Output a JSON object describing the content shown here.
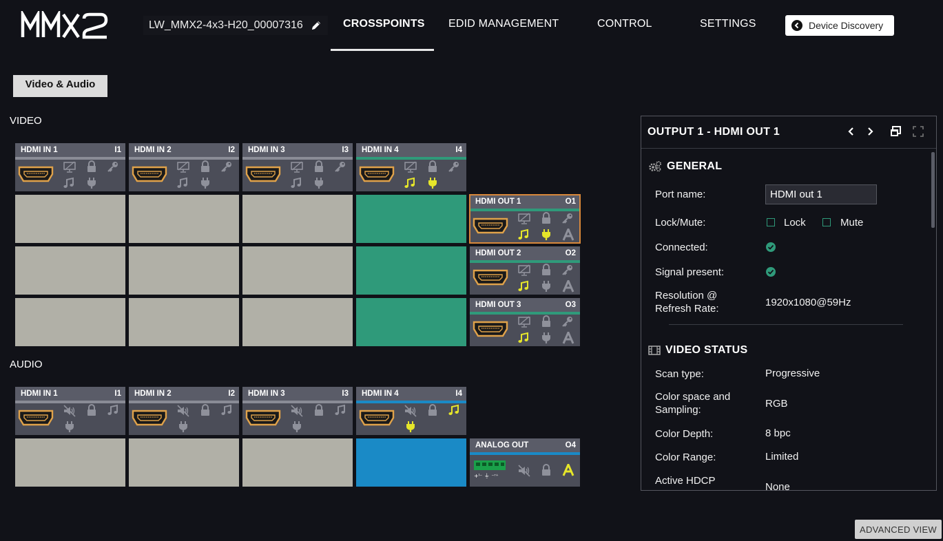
{
  "header": {
    "logo_text": "MMX2",
    "device_name": "LW_MMX2-4x3-H20_00007316",
    "tabs": [
      "CROSSPOINTS",
      "EDID MANAGEMENT",
      "CONTROL",
      "SETTINGS"
    ],
    "active_tab": "CROSSPOINTS",
    "discovery_label": "Device Discovery"
  },
  "toolbar": {
    "view_label": "Video & Audio"
  },
  "video": {
    "title": "VIDEO",
    "inputs": [
      {
        "name": "HDMI IN 1",
        "id": "I1"
      },
      {
        "name": "HDMI IN 2",
        "id": "I2"
      },
      {
        "name": "HDMI IN 3",
        "id": "I3"
      },
      {
        "name": "HDMI IN 4",
        "id": "I4"
      }
    ],
    "outputs": [
      {
        "name": "HDMI OUT 1",
        "id": "O1"
      },
      {
        "name": "HDMI OUT 2",
        "id": "O2"
      },
      {
        "name": "HDMI OUT 3",
        "id": "O3"
      }
    ],
    "connected_input": "I4"
  },
  "audio": {
    "title": "AUDIO",
    "inputs": [
      {
        "name": "HDMI IN 1",
        "id": "I1"
      },
      {
        "name": "HDMI IN 2",
        "id": "I2"
      },
      {
        "name": "HDMI IN 3",
        "id": "I3"
      },
      {
        "name": "HDMI IN 4",
        "id": "I4"
      }
    ],
    "outputs": [
      {
        "name": "ANALOG OUT",
        "id": "O4"
      }
    ],
    "connected_input": "I4"
  },
  "panel": {
    "title": "OUTPUT 1 - HDMI OUT 1",
    "general": {
      "heading": "GENERAL",
      "port_name_label": "Port name:",
      "port_name_value": "HDMI out 1",
      "lock_mute_label": "Lock/Mute:",
      "lock_label": "Lock",
      "mute_label": "Mute",
      "connected_label": "Connected:",
      "signal_label": "Signal present:",
      "resolution_label_1": "Resolution @",
      "resolution_label_2": "Refresh Rate:",
      "resolution_value": "1920x1080@59Hz"
    },
    "video_status": {
      "heading": "VIDEO STATUS",
      "scan_label": "Scan type:",
      "scan_value": "Progressive",
      "color_space_label_1": "Color space and",
      "color_space_label_2": "Sampling:",
      "color_space_value": "RGB",
      "depth_label": "Color Depth:",
      "depth_value": "8 bpc",
      "range_label": "Color Range:",
      "range_value": "Limited",
      "hdcp_label": "Active HDCP",
      "hdcp_value": "None"
    }
  },
  "footer": {
    "advanced_label": "ADVANCED VIEW"
  },
  "colors": {
    "background": "#111218",
    "connected_video": "#2f9a7a",
    "connected_audio": "#1a8ac6",
    "selected_outline": "#d9883a",
    "signal_yellow": "#e6e62a",
    "cell_gray": "#b1b0a7"
  }
}
